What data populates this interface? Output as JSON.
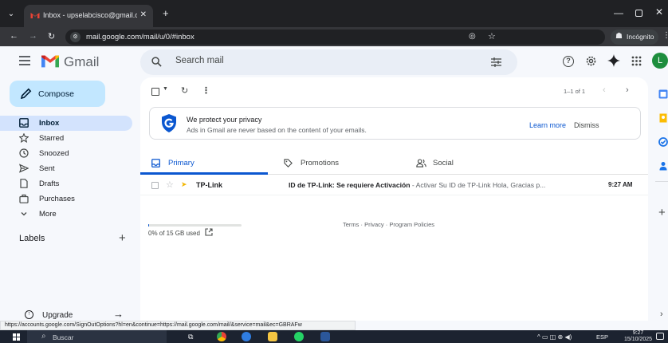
{
  "browser": {
    "tab_title": "Inbox - upselabcisco@gmail.com",
    "url": "mail.google.com/mail/u/0/#inbox",
    "incognito_label": "Incógnito"
  },
  "header": {
    "app_name": "Gmail",
    "search_placeholder": "Search mail",
    "avatar_initial": "L"
  },
  "sidebar": {
    "compose_label": "Compose",
    "items": [
      {
        "label": "Inbox",
        "icon": "inbox-icon",
        "active": true
      },
      {
        "label": "Starred",
        "icon": "star-icon"
      },
      {
        "label": "Snoozed",
        "icon": "clock-icon"
      },
      {
        "label": "Sent",
        "icon": "send-icon"
      },
      {
        "label": "Drafts",
        "icon": "draft-icon"
      },
      {
        "label": "Purchases",
        "icon": "purchases-icon"
      },
      {
        "label": "More",
        "icon": "chevron-down-icon"
      }
    ],
    "labels_title": "Labels",
    "upgrade_label": "Upgrade"
  },
  "toolbar": {
    "pager_text": "1–1 of 1"
  },
  "privacy_banner": {
    "title": "We protect your privacy",
    "subtitle": "Ads in Gmail are never based on the content of your emails.",
    "learn_more": "Learn more",
    "dismiss": "Dismiss"
  },
  "category_tabs": [
    {
      "label": "Primary",
      "icon": "inbox-icon",
      "active": true
    },
    {
      "label": "Promotions",
      "icon": "tag-icon"
    },
    {
      "label": "Social",
      "icon": "people-icon"
    }
  ],
  "emails": [
    {
      "sender": "TP-Link",
      "subject": "ID de TP-Link: Se requiere Activación",
      "snippet": " - Activar Su ID de TP-Link Hola, Gracias p...",
      "time": "9:27 AM",
      "important": true,
      "starred": false
    }
  ],
  "storage": {
    "text": "0% of 15 GB used",
    "fraction_used": 0.0
  },
  "footer_links": "Terms · Privacy · Program Policies",
  "status_url": "https://accounts.google.com/SignOutOptions?hl=en&continue=https://mail.google.com/mail/&service=mail&ec=GBRAFw",
  "taskbar": {
    "search_label": "Buscar",
    "language": "ESP",
    "time": "9:27",
    "date": "15/10/2025"
  },
  "colors": {
    "accent_blue": "#0b57d0",
    "compose_bg": "#c2e7ff",
    "active_nav_bg": "#d3e3fd",
    "search_bg": "#e9eef6",
    "page_bg": "#f6f8fc",
    "important_marker": "#f2b600",
    "avatar_bg": "#1e8e3e"
  }
}
